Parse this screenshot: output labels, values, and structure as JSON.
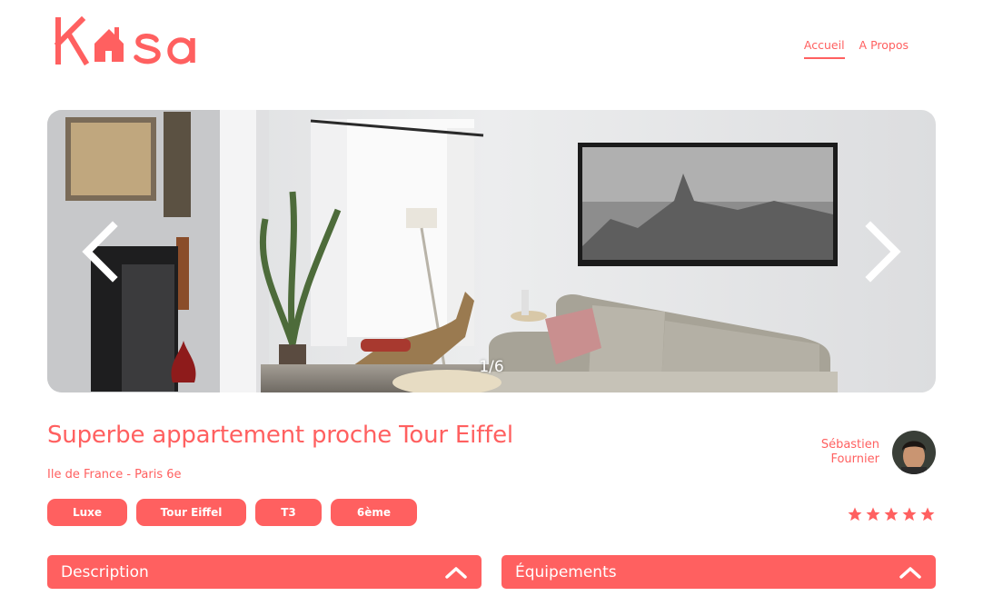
{
  "brand": {
    "name": "Kasa",
    "color": "#FF6060"
  },
  "nav": {
    "items": [
      {
        "label": "Accueil",
        "active": true
      },
      {
        "label": "A Propos",
        "active": false
      }
    ]
  },
  "slideshow": {
    "counter": "1/6",
    "prev_icon": "chevron-left-icon",
    "next_icon": "chevron-right-icon"
  },
  "listing": {
    "title": "Superbe appartement proche Tour Eiffel",
    "location": "Ile de France - Paris 6e",
    "tags": [
      "Luxe",
      "Tour Eiffel",
      "T3",
      "6ème"
    ],
    "host": {
      "first_name": "Sébastien",
      "last_name": "Fournier"
    },
    "rating": {
      "value": 5,
      "max": 5
    }
  },
  "collapses": [
    {
      "label": "Description",
      "icon": "chevron-up-icon"
    },
    {
      "label": "Équipements",
      "icon": "chevron-up-icon"
    }
  ]
}
